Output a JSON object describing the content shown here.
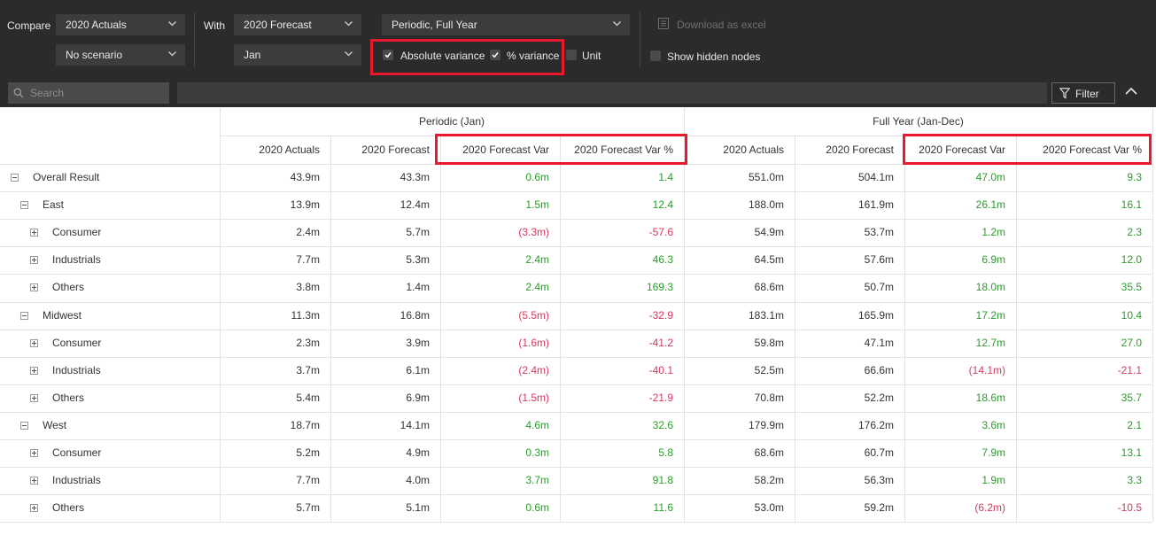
{
  "toolbar": {
    "compare_label": "Compare",
    "with_label": "With",
    "compare_version": "2020 Actuals",
    "compare_scenario": "No scenario",
    "with_version": "2020 Forecast",
    "with_period": "Jan",
    "period_mode": "Periodic, Full Year",
    "absolute_variance": {
      "label": "Absolute variance",
      "checked": true
    },
    "pct_variance": {
      "label": "% variance",
      "checked": true
    },
    "unit": {
      "label": "Unit",
      "checked": false
    },
    "download_label": "Download as excel",
    "show_hidden": {
      "label": "Show hidden nodes",
      "checked": false
    }
  },
  "search": {
    "placeholder": "Search"
  },
  "filter_button": "Filter",
  "table": {
    "groups": [
      "Periodic (Jan)",
      "Full Year (Jan-Dec)"
    ],
    "columns": [
      "2020 Actuals",
      "2020 Forecast",
      "2020 Forecast Var",
      "2020 Forecast Var %",
      "2020 Actuals",
      "2020 Forecast",
      "2020 Forecast Var",
      "2020 Forecast Var %"
    ],
    "rows": [
      {
        "label": "Overall Result",
        "level": 0,
        "expanded": true,
        "values": [
          "43.9m",
          "43.3m",
          "0.6m",
          "1.4",
          "551.0m",
          "504.1m",
          "47.0m",
          "9.3"
        ]
      },
      {
        "label": "East",
        "level": 1,
        "expanded": true,
        "values": [
          "13.9m",
          "12.4m",
          "1.5m",
          "12.4",
          "188.0m",
          "161.9m",
          "26.1m",
          "16.1"
        ]
      },
      {
        "label": "Consumer",
        "level": 2,
        "expanded": false,
        "values": [
          "2.4m",
          "5.7m",
          "(3.3m)",
          "-57.6",
          "54.9m",
          "53.7m",
          "1.2m",
          "2.3"
        ]
      },
      {
        "label": "Industrials",
        "level": 2,
        "expanded": false,
        "values": [
          "7.7m",
          "5.3m",
          "2.4m",
          "46.3",
          "64.5m",
          "57.6m",
          "6.9m",
          "12.0"
        ]
      },
      {
        "label": "Others",
        "level": 2,
        "expanded": false,
        "values": [
          "3.8m",
          "1.4m",
          "2.4m",
          "169.3",
          "68.6m",
          "50.7m",
          "18.0m",
          "35.5"
        ]
      },
      {
        "label": "Midwest",
        "level": 1,
        "expanded": true,
        "values": [
          "11.3m",
          "16.8m",
          "(5.5m)",
          "-32.9",
          "183.1m",
          "165.9m",
          "17.2m",
          "10.4"
        ]
      },
      {
        "label": "Consumer",
        "level": 2,
        "expanded": false,
        "values": [
          "2.3m",
          "3.9m",
          "(1.6m)",
          "-41.2",
          "59.8m",
          "47.1m",
          "12.7m",
          "27.0"
        ]
      },
      {
        "label": "Industrials",
        "level": 2,
        "expanded": false,
        "values": [
          "3.7m",
          "6.1m",
          "(2.4m)",
          "-40.1",
          "52.5m",
          "66.6m",
          "(14.1m)",
          "-21.1"
        ]
      },
      {
        "label": "Others",
        "level": 2,
        "expanded": false,
        "values": [
          "5.4m",
          "6.9m",
          "(1.5m)",
          "-21.9",
          "70.8m",
          "52.2m",
          "18.6m",
          "35.7"
        ]
      },
      {
        "label": "West",
        "level": 1,
        "expanded": true,
        "values": [
          "18.7m",
          "14.1m",
          "4.6m",
          "32.6",
          "179.9m",
          "176.2m",
          "3.6m",
          "2.1"
        ]
      },
      {
        "label": "Consumer",
        "level": 2,
        "expanded": false,
        "values": [
          "5.2m",
          "4.9m",
          "0.3m",
          "5.8",
          "68.6m",
          "60.7m",
          "7.9m",
          "13.1"
        ]
      },
      {
        "label": "Industrials",
        "level": 2,
        "expanded": false,
        "values": [
          "7.7m",
          "4.0m",
          "3.7m",
          "91.8",
          "58.2m",
          "56.3m",
          "1.9m",
          "3.3"
        ]
      },
      {
        "label": "Others",
        "level": 2,
        "expanded": false,
        "values": [
          "5.7m",
          "5.1m",
          "0.6m",
          "11.6",
          "53.0m",
          "59.2m",
          "(6.2m)",
          "-10.5"
        ]
      }
    ]
  },
  "colors": {
    "positive": "#2a9d2a",
    "negative": "#d3395e",
    "highlight": "#e8192c",
    "toolbar_bg": "#2b2b2b"
  }
}
